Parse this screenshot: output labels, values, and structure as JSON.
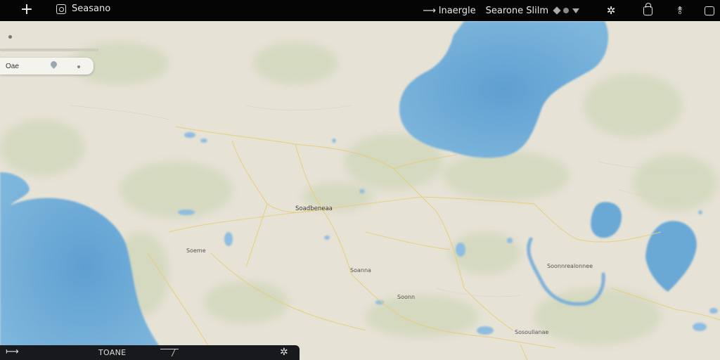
{
  "topbar": {
    "add_label": "+",
    "app_title": "Seasano",
    "arrow_glyph": "⟶",
    "status_a": "lnaergle",
    "status_b": "Searone Slilm",
    "icons": [
      "add-icon",
      "app-icon",
      "arrow-icon",
      "diamond-icon",
      "circle-icon",
      "triangle-down-icon",
      "sparkle-icon",
      "lock-icon",
      "share-icon",
      "window-icon"
    ],
    "sparkle_glyph": "✲",
    "share_glyph": "⥉"
  },
  "search": {
    "value": "Oae",
    "placeholder": ""
  },
  "map": {
    "water_color": "#6aaed8",
    "land_color": "#e6e2d6",
    "road_color": "#e9cf7a",
    "labels": [
      {
        "id": "center-city",
        "text": "Soadbeneaa"
      },
      {
        "id": "south-town",
        "text": "Soanna"
      },
      {
        "id": "west-town",
        "text": "Soeme"
      },
      {
        "id": "lake-town",
        "text": "Soonnrealonnee"
      },
      {
        "id": "bottom-town",
        "text": "Sosoulianae"
      },
      {
        "id": "east-town",
        "text": "Soonn"
      }
    ]
  },
  "bottom_panel": {
    "exit_glyph": "⟼",
    "label": "TOANE",
    "sparkle_glyph": "✲"
  }
}
